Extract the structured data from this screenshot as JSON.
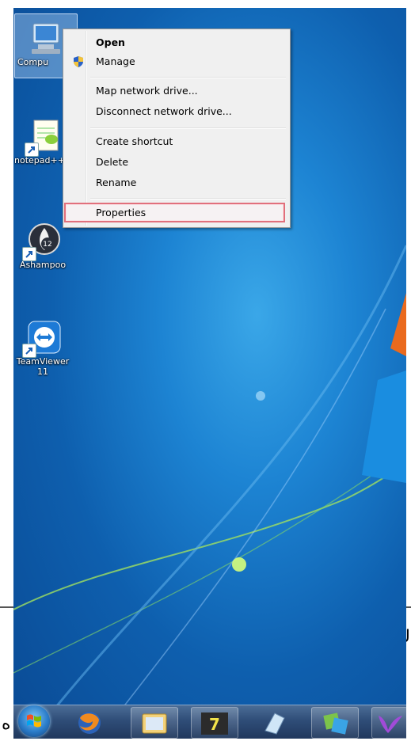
{
  "desktop_icons": [
    {
      "label": "Compu",
      "icon": "computer-icon",
      "selected": true
    },
    {
      "label": "notepad++",
      "icon": "notepad-plus-plus-icon"
    },
    {
      "label": "Ashampoo",
      "icon": "ashampoo-icon"
    },
    {
      "label": "TeamViewer",
      "label2": "11",
      "icon": "teamviewer-icon"
    }
  ],
  "context_menu": {
    "items": [
      {
        "label": "Open",
        "bold": true
      },
      {
        "label": "Manage",
        "icon": "uac-shield-icon"
      },
      {
        "label": "Map network drive..."
      },
      {
        "label": "Disconnect network drive..."
      },
      {
        "label": "Create shortcut"
      },
      {
        "label": "Delete"
      },
      {
        "label": "Rename"
      },
      {
        "label": "Properties",
        "highlighted": true
      }
    ]
  },
  "taskbar": {
    "items": [
      "start-orb-icon",
      "firefox-icon",
      "explorer-icon",
      "7-zip-icon",
      "sticky-notes-icon",
      "windows-live-icon",
      "bird-app-icon"
    ]
  },
  "page_fragments": {
    "right_edge_char": "ك",
    "bottom_left_char": "ه"
  },
  "colors": {
    "highlight_border": "#e1707c",
    "menu_bg": "#f0f0f0"
  }
}
